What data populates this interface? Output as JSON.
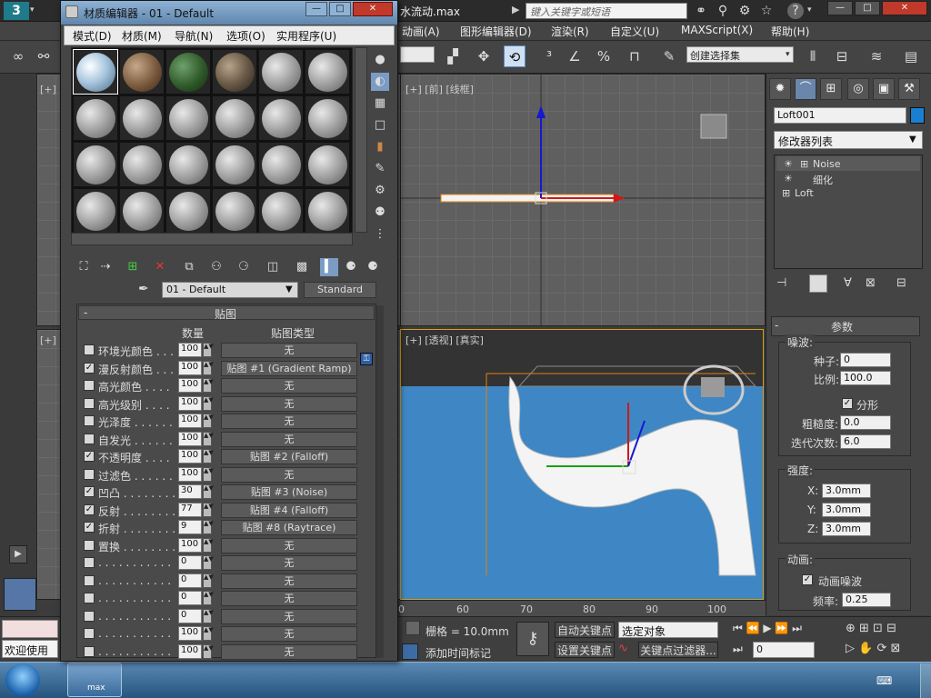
{
  "app": {
    "title": "水流动.max",
    "search_placeholder": "键入关键字或短语",
    "menus": [
      "动画(A)",
      "图形编辑器(D)",
      "渲染(R)",
      "自定义(U)",
      "MAXScript(X)",
      "帮助(H)"
    ],
    "selection_set": "创建选择集",
    "window_controls": [
      "—",
      "□",
      "✕"
    ]
  },
  "viewports": {
    "front_label": "[+] [前] [线框]",
    "persp_label": "[+] [透视] [真实]",
    "top_left_label": "[+]",
    "bottom_left_label": "[+]"
  },
  "command_panel": {
    "object_name": "Loft001",
    "object_color": "#1a7fd1",
    "modifier_list": "修改器列表",
    "stack": [
      "Noise",
      "细化",
      "Loft"
    ],
    "params_title": "参数",
    "noise_group": "噪波:",
    "seed_label": "种子:",
    "seed_value": "0",
    "scale_label": "比例:",
    "scale_value": "100.0",
    "fractal_label": "分形",
    "roughness_label": "粗糙度:",
    "roughness_value": "0.0",
    "iterations_label": "迭代次数:",
    "iterations_value": "6.0",
    "strength_group": "强度:",
    "x_label": "X:",
    "x_value": "3.0mm",
    "y_label": "Y:",
    "y_value": "3.0mm",
    "z_label": "Z:",
    "z_value": "3.0mm",
    "anim_group": "动画:",
    "anim_noise_label": "动画噪波",
    "freq_label": "频率:",
    "freq_value": "0.25"
  },
  "timeline": {
    "ticks": [
      "0",
      "60",
      "70",
      "80",
      "90",
      "100"
    ]
  },
  "status": {
    "welcome": "欢迎使用",
    "grid": "栅格 = 10.0mm",
    "add_time_tag": "添加时间标记",
    "auto_key": "自动关键点",
    "set_key": "设置关键点",
    "selected_object": "选定对象",
    "key_filter": "关键点过滤器...",
    "frame": "0"
  },
  "material_editor": {
    "title": "材质编辑器 - 01 - Default",
    "menus": [
      "模式(D)",
      "材质(M)",
      "导航(N)",
      "选项(O)",
      "实用程序(U)"
    ],
    "material_name": "01 - Default",
    "material_type": "Standard",
    "maps_title": "贴图",
    "col_amount": "数量",
    "col_maptype": "贴图类型",
    "maps": [
      {
        "name": "环境光颜色 . . .",
        "checked": false,
        "amount": "100",
        "map": "无"
      },
      {
        "name": "漫反射颜色 . . .",
        "checked": true,
        "amount": "100",
        "map": "贴图 #1 (Gradient Ramp)"
      },
      {
        "name": "高光颜色 . . . .",
        "checked": false,
        "amount": "100",
        "map": "无"
      },
      {
        "name": "高光级别 . . . .",
        "checked": false,
        "amount": "100",
        "map": "无"
      },
      {
        "name": "光泽度 . . . . . .",
        "checked": false,
        "amount": "100",
        "map": "无"
      },
      {
        "name": "自发光 . . . . . .",
        "checked": false,
        "amount": "100",
        "map": "无"
      },
      {
        "name": "不透明度 . . . .",
        "checked": true,
        "amount": "100",
        "map": "贴图 #2 (Falloff)"
      },
      {
        "name": "过滤色 . . . . . .",
        "checked": false,
        "amount": "100",
        "map": "无"
      },
      {
        "name": "凹凸 . . . . . . . .",
        "checked": true,
        "amount": "30",
        "map": "贴图 #3 (Noise)"
      },
      {
        "name": "反射 . . . . . . . .",
        "checked": true,
        "amount": "77",
        "map": "贴图 #4 (Falloff)"
      },
      {
        "name": "折射 . . . . . . . .",
        "checked": true,
        "amount": "9",
        "map": "贴图 #8 (Raytrace)"
      },
      {
        "name": "置换 . . . . . . . .",
        "checked": false,
        "amount": "100",
        "map": "无"
      },
      {
        "name": ". . . . . . . . . . .",
        "checked": false,
        "amount": "0",
        "map": "无"
      },
      {
        "name": ". . . . . . . . . . .",
        "checked": false,
        "amount": "0",
        "map": "无"
      },
      {
        "name": ". . . . . . . . . . .",
        "checked": false,
        "amount": "0",
        "map": "无"
      },
      {
        "name": ". . . . . . . . . . .",
        "checked": false,
        "amount": "0",
        "map": "无"
      },
      {
        "name": ". . . . . . . . . . .",
        "checked": false,
        "amount": "100",
        "map": "无"
      },
      {
        "name": ". . . . . . . . . . .",
        "checked": false,
        "amount": "100",
        "map": "无"
      }
    ]
  },
  "taskbar": {
    "start_icon": "windows-orb-icon",
    "app_icon": "max-app-icon",
    "app_label": "max"
  }
}
